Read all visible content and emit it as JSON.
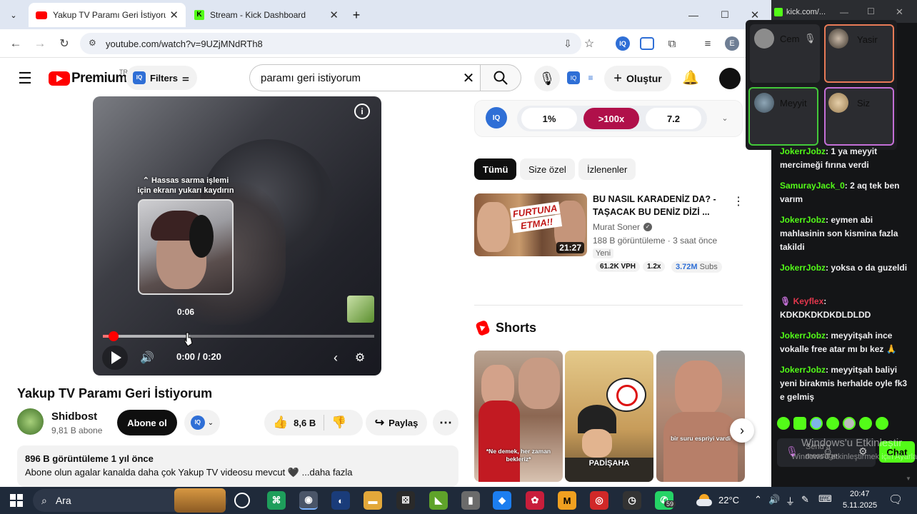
{
  "browser": {
    "tabs": [
      {
        "title": "Yakup TV Paramı Geri İstiyorum"
      },
      {
        "title": "Stream - Kick Dashboard"
      }
    ],
    "url": "youtube.com/watch?v=9UZjMNdRTh8",
    "profile_initial": "E"
  },
  "youtube": {
    "logo_text": "Premium",
    "logo_sup": "TR",
    "filters_label": "Filters",
    "search_value": "paramı geri istiyorum",
    "create_label": "Oluştur",
    "player": {
      "scroll_hint_1": "Hassas sarma işlemi",
      "scroll_hint_2": "için ekranı yukarı kaydırın",
      "preview_time": "0:06",
      "time_display": "0:00 / 0:20",
      "progress_fraction": 0.04
    },
    "video_title": "Yakup TV Paramı Geri İstiyorum",
    "channel_name": "Shidbost",
    "subscribers": "9,81 B abone",
    "subscribe_label": "Abone ol",
    "like_count": "8,6 B",
    "share_label": "Paylaş",
    "description": {
      "meta": "896 B görüntüleme  1 yıl önce",
      "text": "Abone olun agalar kanalda daha çok Yakup TV videosu mevcut 🖤 ...daha fazla"
    },
    "ext_bar": {
      "pills": [
        "1%",
        ">100x",
        "7.2"
      ]
    },
    "chips": [
      "Tümü",
      "Size özel",
      "İzlenenler"
    ],
    "rec": {
      "title": "BU NASIL KARADENİZ DA? - TAŞACAK BU DENİZ DİZİ ...",
      "channel": "Murat Soner",
      "meta": "188 B görüntüleme · 3 saat önce",
      "badge": "Yeni",
      "duration": "21:27",
      "thumb_text_1": "FURTUNA",
      "thumb_text_2": "ETMA!!",
      "stats": [
        "61.2K VPH",
        "1.2x"
      ],
      "subs_value": "3.72M",
      "subs_label": "Subs"
    },
    "shorts_title": "Shorts",
    "shorts": [
      {
        "caption": "*Ne demek, her zaman bekleriz*"
      },
      {
        "caption": "PADİŞAHA"
      },
      {
        "caption": "bir suru espriyi vardi"
      }
    ]
  },
  "kick": {
    "tab_title": "kick.com/...",
    "callers": [
      {
        "name": "Cem"
      },
      {
        "name": "Yasir"
      },
      {
        "name": "Meyyit"
      },
      {
        "name": "Siz"
      }
    ],
    "messages": [
      {
        "user": "JokerrJobz",
        "text": " 1 ya meyyit mercimeği fırına verdi"
      },
      {
        "user": "SamurayJack_0",
        "text": " 2 aq tek ben varım"
      },
      {
        "user": "JokerrJobz",
        "text": " eymen abi mahlasinin son kismina fazla takildi"
      },
      {
        "user": "JokerrJobz",
        "text": " yoksa o da guzeldi"
      },
      {
        "user": "Keyflex",
        "text": " KDKDKDKDKDLDLDD"
      },
      {
        "user": "JokerrJobz",
        "text": " meyyitşah ince vokalle free atar mı bı kez 🙏"
      },
      {
        "user": "JokerrJobz",
        "text": " meyyitşah baliyi yeni birakmis herhalde oyle fk3 e gelmiş"
      }
    ],
    "send_placeholder": "Send a message",
    "chat_button": "Chat",
    "watermark_1": "Windows'u Etkinleştir",
    "watermark_2": "Windows'u etkinleştirmek için Ayarlar'a gidin."
  },
  "taskbar": {
    "search_label": "Ara",
    "temperature": "22°C",
    "time": "20:47",
    "date": "5.11.2025",
    "badge_count": "59"
  },
  "colors": {
    "yt_red": "#ff0000",
    "kick_green": "#53fc18",
    "taskbar": "#1f2a3a"
  }
}
